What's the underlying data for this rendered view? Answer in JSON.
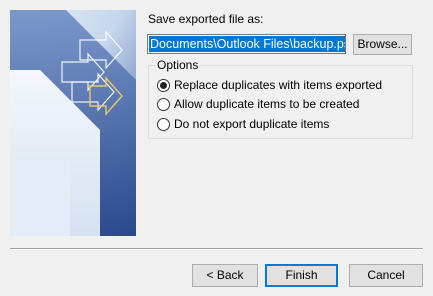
{
  "save": {
    "label": "Save exported file as:",
    "path_value": "Documents\\Outlook Files\\backup.pst",
    "browse_label": "Browse..."
  },
  "options": {
    "legend": "Options",
    "items": [
      {
        "label": "Replace duplicates with items exported",
        "checked": true
      },
      {
        "label": "Allow duplicate items to be created",
        "checked": false
      },
      {
        "label": "Do not export duplicate items",
        "checked": false
      }
    ]
  },
  "footer": {
    "back_label": "< Back",
    "finish_label": "Finish",
    "cancel_label": "Cancel"
  },
  "colors": {
    "accent": "#0078d7",
    "banner_dark": "#3b5a9a",
    "banner_light": "#c8d8ee"
  },
  "icons": {
    "banner": "wizard-banner-graphic"
  }
}
